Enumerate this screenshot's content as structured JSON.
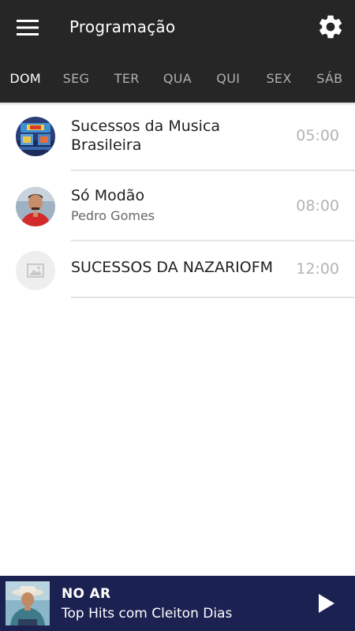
{
  "header": {
    "title": "Programação",
    "menu_icon": "hamburger-menu-icon",
    "settings_icon": "gear-icon"
  },
  "tabs": [
    {
      "label": "DOM",
      "active": true
    },
    {
      "label": "SEG",
      "active": false
    },
    {
      "label": "TER",
      "active": false
    },
    {
      "label": "QUA",
      "active": false
    },
    {
      "label": "QUI",
      "active": false
    },
    {
      "label": "SEX",
      "active": false
    },
    {
      "label": "SÁB",
      "active": false
    }
  ],
  "schedule": [
    {
      "title_line1": "Sucessos da Musica",
      "title_line2": "Brasileira",
      "subtitle": "",
      "time": "05:00",
      "avatar": "program-photo"
    },
    {
      "title_line1": "Só Modão",
      "title_line2": "",
      "subtitle": "Pedro Gomes",
      "time": "08:00",
      "avatar": "host-photo"
    },
    {
      "title_line1": "SUCESSOS DA NAZARIOFM",
      "title_line2": "",
      "subtitle": "",
      "time": "12:00",
      "avatar": "image-placeholder-icon"
    }
  ],
  "player": {
    "status": "NO AR",
    "show": "Top Hits com Cleiton Dias",
    "play_icon": "play-icon"
  },
  "colors": {
    "appbar": "#262626",
    "player_bar": "#1b2150",
    "time_text": "#b3b3b3"
  }
}
